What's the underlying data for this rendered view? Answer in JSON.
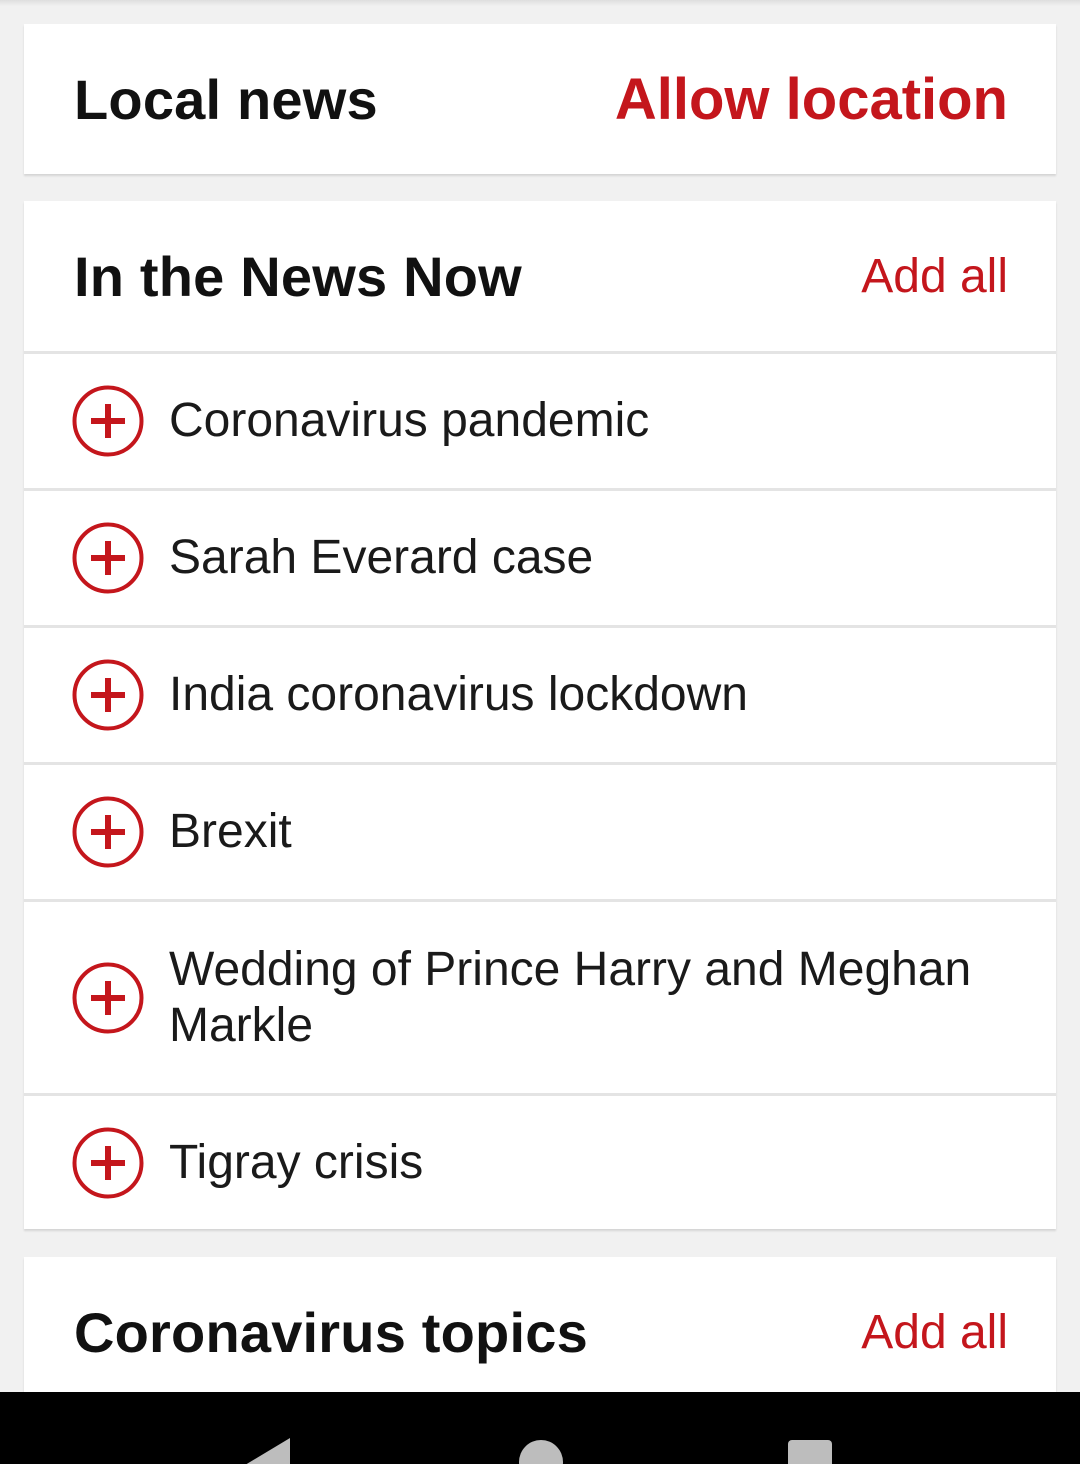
{
  "local_news": {
    "title": "Local news",
    "action": "Allow location"
  },
  "in_the_news": {
    "title": "In the News Now",
    "action": "Add all",
    "topics": [
      {
        "label": "Coronavirus pandemic",
        "icon": "add-circle-icon"
      },
      {
        "label": "Sarah Everard case",
        "icon": "add-circle-icon"
      },
      {
        "label": "India coronavirus lockdown",
        "icon": "add-circle-icon"
      },
      {
        "label": "Brexit",
        "icon": "add-circle-icon"
      },
      {
        "label": "Wedding of Prince Harry and Meghan Markle",
        "icon": "add-circle-icon"
      },
      {
        "label": "Tigray crisis",
        "icon": "add-circle-icon"
      }
    ]
  },
  "coronavirus_topics": {
    "title": "Coronavirus topics",
    "action": "Add all"
  },
  "colors": {
    "accent": "#c4161c",
    "background": "#f1f1f1",
    "card": "#ffffff",
    "text": "#111111"
  },
  "nav_bar": {
    "icons": [
      "back-icon",
      "home-icon",
      "recents-icon"
    ]
  }
}
